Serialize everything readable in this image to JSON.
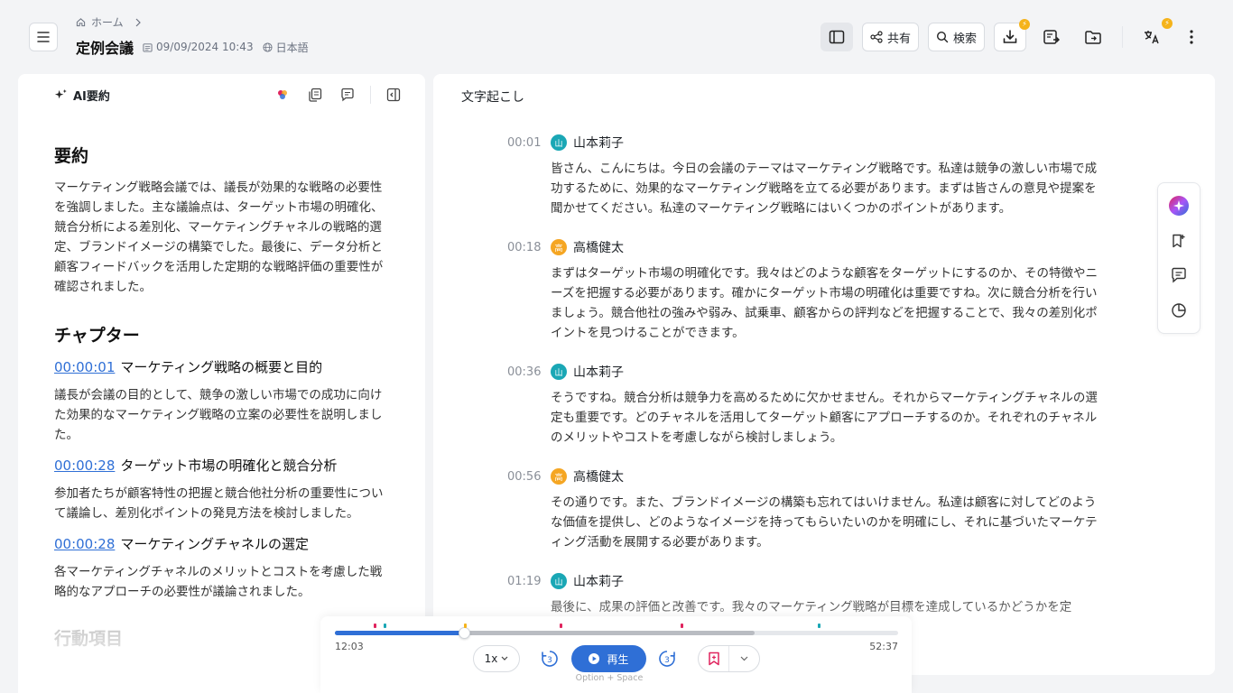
{
  "header": {
    "breadcrumb_home": "ホーム",
    "title": "定例会議",
    "date": "09/09/2024 10:43",
    "language": "日本語",
    "share_label": "共有",
    "search_label": "検索"
  },
  "summary_panel": {
    "title": "AI要約",
    "summary_heading": "要約",
    "summary_text": "マーケティング戦略会議では、議長が効果的な戦略の必要性を強調しました。主な議論点は、ターゲット市場の明確化、競合分析による差別化、マーケティングチャネルの戦略的選定、ブランドイメージの構築でした。最後に、データ分析と顧客フィードバックを活用した定期的な戦略評価の重要性が確認されました。",
    "chapters_heading": "チャプター",
    "chapters": [
      {
        "time": "00:00:01",
        "title": "マーケティング戦略の概要と目的",
        "text": "議長が会議の目的として、競争の激しい市場での成功に向けた効果的なマーケティング戦略の立案の必要性を説明しました。"
      },
      {
        "time": "00:00:28",
        "title": "ターゲット市場の明確化と競合分析",
        "text": "参加者たちが顧客特性の把握と競合他社分析の重要性について議論し、差別化ポイントの発見方法を検討しました。"
      },
      {
        "time": "00:00:28",
        "title": "マーケティングチャネルの選定",
        "text": "各マーケティングチャネルのメリットとコストを考慮した戦略的なアプローチの必要性が議論されました。"
      }
    ],
    "actions_heading": "行動項目"
  },
  "transcript": {
    "title": "文字起こし",
    "segments": [
      {
        "time": "00:01",
        "speaker": "山本莉子",
        "initial": "山",
        "color": "#1aa7b5",
        "text": "皆さん、こんにちは。今日の会議のテーマはマーケティング戦略です。私達は競争の激しい市場で成功するために、効果的なマーケティング戦略を立てる必要があります。まずは皆さんの意見や提案を聞かせてください。私達のマーケティング戦略にはいくつかのポイントがあります。"
      },
      {
        "time": "00:18",
        "speaker": "高橋健太",
        "initial": "高",
        "color": "#f5a623",
        "text": "まずはターゲット市場の明確化です。我々はどのような顧客をターゲットにするのか、その特徴やニーズを把握する必要があります。確かにターゲット市場の明確化は重要ですね。次に競合分析を行いましょう。競合他社の強みや弱み、試乗車、顧客からの評判などを把握することで、我々の差別化ポイントを見つけることができます。"
      },
      {
        "time": "00:36",
        "speaker": "山本莉子",
        "initial": "山",
        "color": "#1aa7b5",
        "text": "そうですね。競合分析は競争力を高めるために欠かせません。それからマーケティングチャネルの選定も重要です。どのチャネルを活用してターゲット顧客にアプローチするのか。それぞれのチャネルのメリットやコストを考慮しながら検討しましょう。"
      },
      {
        "time": "00:56",
        "speaker": "高橋健太",
        "initial": "高",
        "color": "#f5a623",
        "text": "その通りです。また、ブランドイメージの構築も忘れてはいけません。私達は顧客に対してどのような価値を提供し、どのようなイメージを持ってもらいたいのかを明確にし、それに基づいたマーケティング活動を展開する必要があります。"
      },
      {
        "time": "01:19",
        "speaker": "山本莉子",
        "initial": "山",
        "color": "#1aa7b5",
        "text": "最後に、成果の評価と改善です。我々のマーケティング戦略が目標を達成しているかどうかを定"
      }
    ]
  },
  "player": {
    "current_time": "12:03",
    "total_time": "52:37",
    "speed": "1x",
    "play_label": "再生",
    "shortcut_hint": "Option + Space",
    "skip_back_seconds": "3",
    "skip_forward_seconds": "3",
    "progress_fraction": 0.229,
    "buffered_fraction": 0.745,
    "markers": [
      {
        "pos": 0.069,
        "color": "#e0245e"
      },
      {
        "pos": 0.086,
        "color": "#1aa7b5"
      },
      {
        "pos": 0.229,
        "color": "#f5b31b"
      },
      {
        "pos": 0.399,
        "color": "#e0245e"
      },
      {
        "pos": 0.614,
        "color": "#e0245e"
      },
      {
        "pos": 0.857,
        "color": "#1aa7b5"
      }
    ]
  }
}
